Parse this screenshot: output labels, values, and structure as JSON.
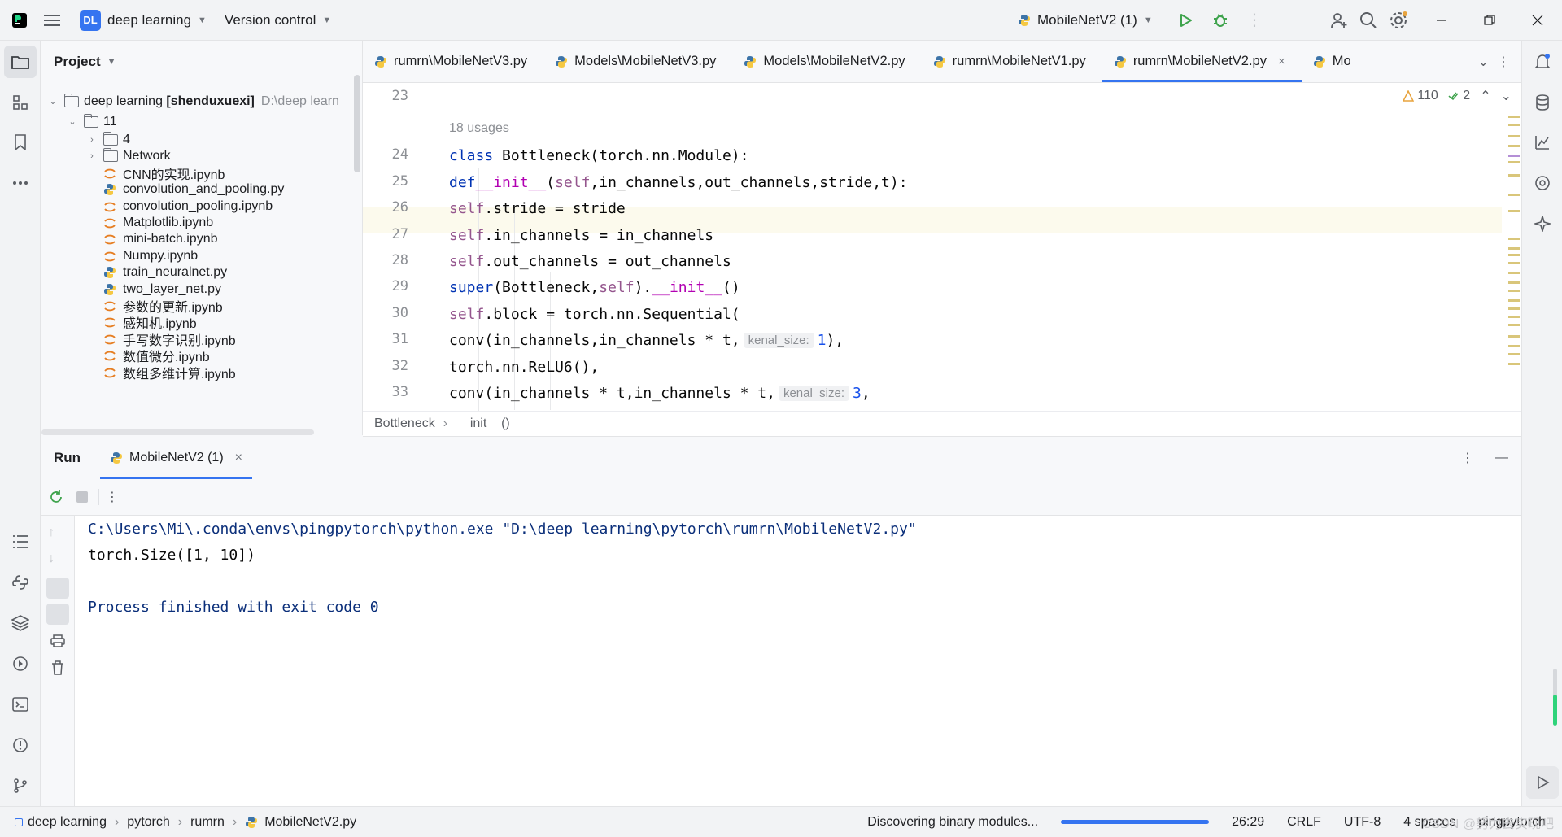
{
  "titlebar": {
    "project_badge": "DL",
    "project_name": "deep learning",
    "vcs": "Version control",
    "run_config": "MobileNetV2 (1)"
  },
  "project_panel": {
    "title": "Project",
    "root": {
      "name": "deep learning",
      "module": "[shenduxuexi]",
      "path": "D:\\deep learn"
    },
    "folder_11": "11",
    "items": [
      {
        "kind": "folder",
        "label": "4"
      },
      {
        "kind": "folder",
        "label": "Network"
      },
      {
        "kind": "notebook",
        "label": "CNN的实现.ipynb"
      },
      {
        "kind": "python",
        "label": "convolution_and_pooling.py"
      },
      {
        "kind": "notebook",
        "label": "convolution_pooling.ipynb"
      },
      {
        "kind": "notebook",
        "label": "Matplotlib.ipynb"
      },
      {
        "kind": "notebook",
        "label": "mini-batch.ipynb"
      },
      {
        "kind": "notebook",
        "label": "Numpy.ipynb"
      },
      {
        "kind": "python",
        "label": "train_neuralnet.py"
      },
      {
        "kind": "python",
        "label": "two_layer_net.py"
      },
      {
        "kind": "notebook",
        "label": "参数的更新.ipynb"
      },
      {
        "kind": "notebook",
        "label": "感知机.ipynb"
      },
      {
        "kind": "notebook",
        "label": "手写数字识别.ipynb"
      },
      {
        "kind": "notebook",
        "label": "数值微分.ipynb"
      },
      {
        "kind": "notebook",
        "label": "数组多维计算.ipynb"
      }
    ]
  },
  "tabs": [
    {
      "label": "rumrn\\MobileNetV3.py"
    },
    {
      "label": "Models\\MobileNetV3.py"
    },
    {
      "label": "Models\\MobileNetV2.py"
    },
    {
      "label": "rumrn\\MobileNetV1.py"
    },
    {
      "label": "rumrn\\MobileNetV2.py"
    },
    {
      "label": "Mo"
    }
  ],
  "editor": {
    "warnings": "110",
    "ok_count": "2",
    "usages": "18 usages",
    "lines": [
      "23",
      "24",
      "25",
      "26",
      "27",
      "28",
      "29",
      "30",
      "31",
      "32",
      "33"
    ],
    "code": {
      "l24_kw": "class",
      "l24_rest": " Bottleneck(torch.nn.Module):",
      "l25_kw": "def",
      "l25_fn": "__init__",
      "l25_self": "self",
      "l25_rest": ",in_channels,out_channels,stride,t):",
      "l26_self": "self",
      "l26_rest": ".stride = stride",
      "l27_self": "self",
      "l27_rest": ".in_channels = in_channels",
      "l28_self": "self",
      "l28_rest": ".out_channels = out_channels",
      "l29_super": "super",
      "l29_a": "(Bottleneck,",
      "l29_self": "self",
      "l29_b": ").",
      "l29_init": "__init__",
      "l29_c": "()",
      "l30_self": "self",
      "l30_rest": ".block = torch.nn.Sequential(",
      "l31_a": "conv(in_channels,in_channels * t,",
      "l31_hint": "kenal_size:",
      "l31_num": "1",
      "l31_b": "),",
      "l32": "torch.nn.ReLU6(),",
      "l33_a": "conv(in_channels * t,in_channels * t,",
      "l33_hint": "kenal_size:",
      "l33_num": "3",
      "l33_b": ","
    }
  },
  "breadcrumb": {
    "a": "Bottleneck",
    "b": "__init__()"
  },
  "run": {
    "title": "Run",
    "tab": "MobileNetV2 (1)",
    "console": [
      "C:\\Users\\Mi\\.conda\\envs\\pingpytorch\\python.exe \"D:\\deep learning\\pytorch\\rumrn\\MobileNetV2.py\"",
      "torch.Size([1, 10])",
      "",
      "Process finished with exit code 0"
    ]
  },
  "statusbar": {
    "crumbs": [
      "deep learning",
      "pytorch",
      "rumrn",
      "MobileNetV2.py"
    ],
    "task": "Discovering binary modules...",
    "progress": 1.0,
    "position": "26:29",
    "line_sep": "CRLF",
    "encoding": "UTF-8",
    "indent": "4 spaces",
    "interpreter": "pingpytorch",
    "watermark": "CSDN @努力去实现吧"
  },
  "colors": {
    "accent": "#3574f0",
    "keyword": "#0033b3",
    "self": "#94558d",
    "dunder": "#b200b2",
    "number": "#1750eb"
  }
}
